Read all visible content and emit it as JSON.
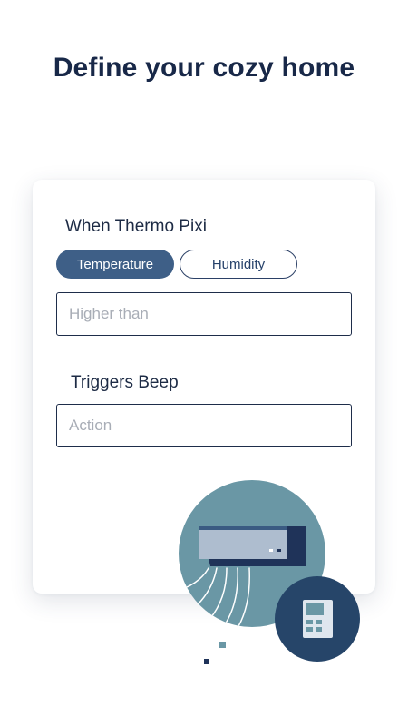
{
  "header": {
    "title": "Define your cozy home"
  },
  "card": {
    "condition_label": "When Thermo Pixi",
    "tabs": [
      {
        "label": "Temperature",
        "selected": true
      },
      {
        "label": "Humidity",
        "selected": false
      }
    ],
    "condition_input": {
      "value": "",
      "placeholder": "Higher than"
    },
    "trigger_label": "Triggers Beep",
    "action_input": {
      "value": "",
      "placeholder": "Action"
    }
  },
  "illustration": {
    "icons": [
      "air-conditioner-icon",
      "remote-control-icon"
    ]
  },
  "colors": {
    "title": "#182848",
    "accent": "#3e5f87",
    "circle_light": "#6a97a5",
    "circle_dark": "#264569",
    "navy": "#1f3359",
    "placeholder": "#a8adb6"
  }
}
